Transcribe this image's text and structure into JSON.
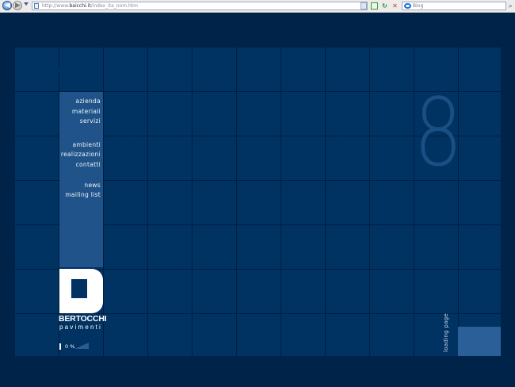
{
  "browser": {
    "url_prefix": "http://www.",
    "url_domain": "baicchi.it",
    "url_path": "/index_ita_nom.htm",
    "search_placeholder": "Bing"
  },
  "site": {
    "menu": {
      "group1": [
        "azienda",
        "materiali",
        "servizi"
      ],
      "group2": [
        "ambienti",
        "realizzazioni",
        "contatti"
      ],
      "group3": [
        "news",
        "mailing list"
      ]
    },
    "big_number": "8",
    "brand_name": "BERTOCCHI",
    "brand_sub": "pavimenti",
    "loader_percent": "0 %",
    "loading_label": "loading page"
  },
  "colors": {
    "page_bg": "#002449",
    "grid_bg": "#003262",
    "menu_column": "#1f5389",
    "accent_box": "#2a5f98",
    "big_number": "#1a4f84"
  }
}
